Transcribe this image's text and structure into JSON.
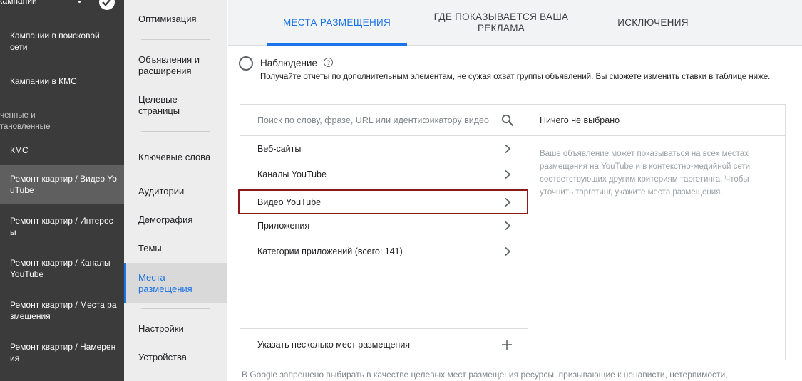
{
  "sidebar": {
    "top_title": "кампании",
    "items": [
      {
        "label": "Кампании в поисковой сети"
      },
      {
        "label": "Кампании в КМС"
      },
      {
        "label": "оченные и становленные"
      },
      {
        "label": "КМС"
      },
      {
        "label": "Ремонт квартир / Видео YouTube"
      },
      {
        "label": "Ремонт квартир / Интересы"
      },
      {
        "label": "Ремонт квартир / Каналы YouTube"
      },
      {
        "label": "Ремонт квартир / Места размещения"
      },
      {
        "label": "Ремонт квартир / Намерения"
      }
    ]
  },
  "subnav": {
    "items": [
      {
        "label": "Оптимизация"
      },
      {
        "label": "Объявления и расширения"
      },
      {
        "label": "Целевые страницы"
      },
      {
        "label": "Ключевые слова"
      },
      {
        "label": "Аудитории"
      },
      {
        "label": "Демография"
      },
      {
        "label": "Темы"
      },
      {
        "label": "Места размещения"
      },
      {
        "label": "Настройки"
      },
      {
        "label": "Устройства"
      }
    ],
    "active_index": 7
  },
  "tabs": [
    {
      "label": "МЕСТА РАЗМЕЩЕНИЯ",
      "active": true
    },
    {
      "label": "ГДЕ ПОКАЗЫВАЕТСЯ ВАША РЕКЛАМА",
      "active": false
    },
    {
      "label": "ИСКЛЮЧЕНИЯ",
      "active": false
    }
  ],
  "observation": {
    "title": "Наблюдение",
    "description": "Получайте отчеты по дополнительным элементам, не сужая охват группы объявлений. Вы сможете изменить ставки в таблице ниже.",
    "selected": false
  },
  "search": {
    "placeholder": "Поиск по слову, фразе, URL или идентификатору видео"
  },
  "categories": [
    {
      "label": "Веб-сайты"
    },
    {
      "label": "Каналы YouTube"
    },
    {
      "label": "Видео YouTube"
    },
    {
      "label": "Приложения"
    },
    {
      "label": "Категории приложений (всего: 141)"
    }
  ],
  "selected_category_index": 2,
  "multi_placement_label": "Указать несколько мест размещения",
  "right_panel": {
    "header": "Ничего не выбрано",
    "body": "Ваше объявление может показываться на всех местах размещения на YouTube и в контекстно-медийной сети, соответствующих другим критериям таргетинга. Чтобы уточнить таргетинг, укажите места размещения."
  },
  "footer_note": "В Google запрещено выбирать в качестве целевых мест размещения ресурсы, призывающие к ненависти, нетерпимости,",
  "colors": {
    "accent": "#1a73e8",
    "sidebar_bg": "#3b3b3b",
    "selection_border": "#8b1a1a"
  }
}
